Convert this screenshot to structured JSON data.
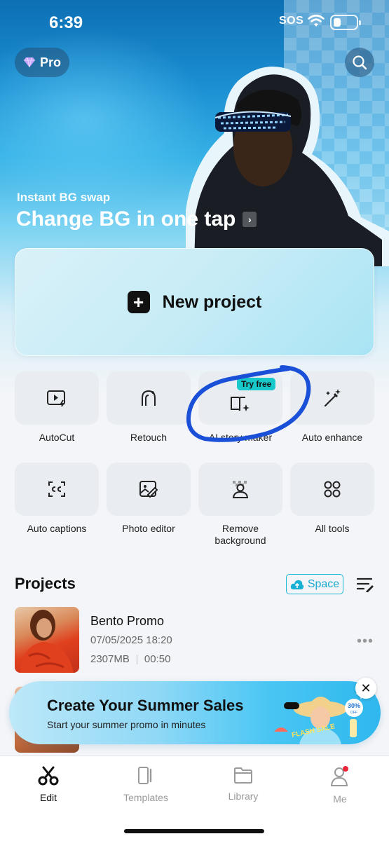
{
  "status_bar": {
    "time": "6:39",
    "carrier": "SOS"
  },
  "header": {
    "pro_label": "Pro",
    "icons": {
      "pro": "diamond-icon",
      "search": "search-icon"
    }
  },
  "banner": {
    "subtitle": "Instant BG swap",
    "title": "Change BG in one tap"
  },
  "new_project": {
    "label": "New project"
  },
  "tools": [
    {
      "label": "AutoCut",
      "icon": "autocut-icon"
    },
    {
      "label": "Retouch",
      "icon": "retouch-icon"
    },
    {
      "label": "AI story maker",
      "icon": "story-book-icon",
      "badge": "Try free"
    },
    {
      "label": "Auto enhance",
      "icon": "magic-wand-icon"
    },
    {
      "label": "Auto captions",
      "icon": "captions-icon"
    },
    {
      "label": "Photo editor",
      "icon": "photo-edit-icon"
    },
    {
      "label": "Remove background",
      "icon": "remove-bg-icon"
    },
    {
      "label": "All tools",
      "icon": "grid-icon"
    }
  ],
  "projects": {
    "title": "Projects",
    "space_label": "Space",
    "items": [
      {
        "name": "Bento Promo",
        "date": "07/05/2025 18:20",
        "size": "2307MB",
        "duration": "00:50"
      }
    ]
  },
  "promo": {
    "title": "Create Your Summer Sales",
    "subtitle": "Start your summer promo in minutes",
    "art_text": "FLASH SALE",
    "discount": "30%",
    "discount_sub": "OFF"
  },
  "tab_bar": {
    "tabs": [
      {
        "label": "Edit",
        "icon": "scissors-icon",
        "active": true
      },
      {
        "label": "Templates",
        "icon": "templates-icon",
        "active": false
      },
      {
        "label": "Library",
        "icon": "folder-icon",
        "active": false
      },
      {
        "label": "Me",
        "icon": "person-icon",
        "active": false
      }
    ]
  },
  "colors": {
    "accent": "#19c8c8",
    "annotation": "#1a4fd8",
    "notification": "#e8283a"
  }
}
